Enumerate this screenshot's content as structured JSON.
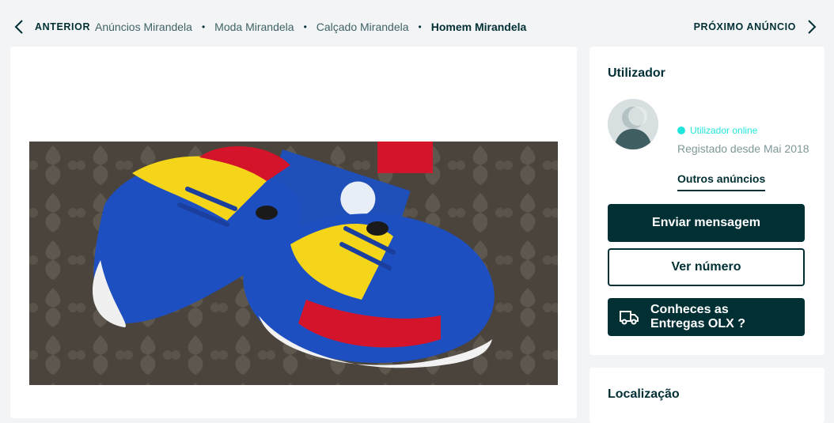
{
  "nav": {
    "prev_label": "ANTERIOR",
    "next_label": "PRÓXIMO ANÚNCIO"
  },
  "breadcrumb": [
    {
      "label": "Anúncios Mirandela"
    },
    {
      "label": "Moda Mirandela"
    },
    {
      "label": "Calçado Mirandela"
    },
    {
      "label": "Homem Mirandela"
    }
  ],
  "breadcrumb_separator": "•",
  "user": {
    "section_title": "Utilizador",
    "online_status": "Utilizador online",
    "registered": "Registado desde Mai 2018",
    "other_ads": "Outros anúncios",
    "send_message": "Enviar mensagem",
    "show_number": "Ver número",
    "delivery_promo": "Conheces as Entregas OLX ?"
  },
  "location": {
    "section_title": "Localização"
  },
  "colors": {
    "brand_dark": "#002f34",
    "online": "#23e5db",
    "background": "#f2f4f5"
  },
  "icons": {
    "prev": "chevron-left-icon",
    "next": "chevron-right-icon",
    "delivery": "truck-icon",
    "avatar": "user-avatar-icon"
  }
}
